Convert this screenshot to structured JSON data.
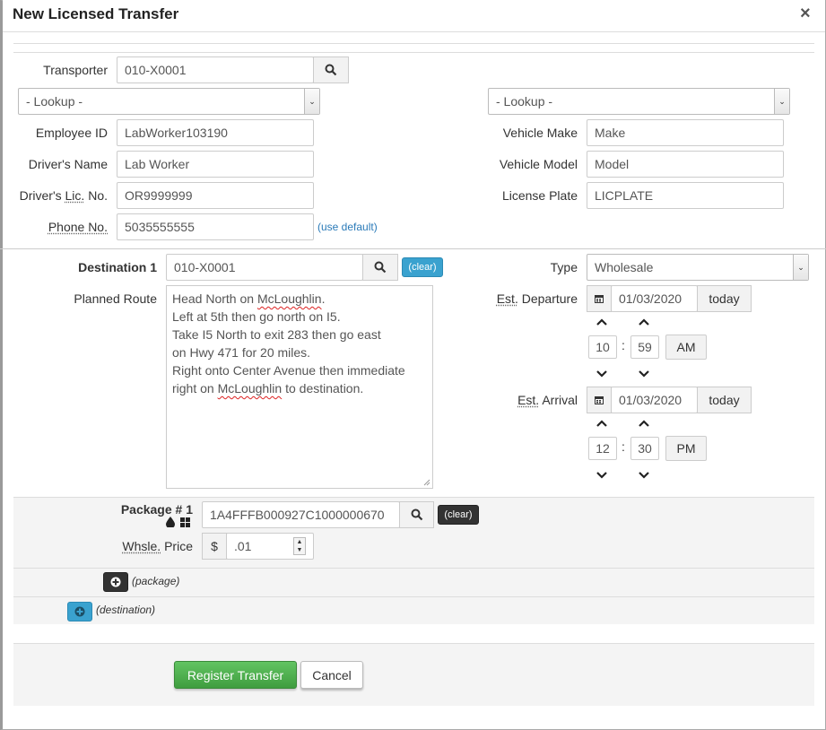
{
  "dialog": {
    "title": "New Licensed Transfer",
    "close": "×"
  },
  "transporter": {
    "label": "Transporter",
    "value": "010-X0001",
    "lookup_left": "- Lookup -",
    "lookup_right": "- Lookup -",
    "employee_id_label": "Employee ID",
    "employee_id": "LabWorker103190",
    "driver_name_label": "Driver's Name",
    "driver_name": "Lab Worker",
    "driver_lic_label_pre": "Driver's ",
    "driver_lic_label_abbr": "Lic.",
    "driver_lic_label_post": " No.",
    "driver_lic": "OR9999999",
    "phone_label": "Phone No.",
    "phone": "5035555555",
    "use_default": "(use default)",
    "vehicle_make_label": "Vehicle Make",
    "vehicle_make": "Make",
    "vehicle_model_label": "Vehicle Model",
    "vehicle_model": "Model",
    "license_plate_label": "License Plate",
    "license_plate": "LICPLATE"
  },
  "destination": {
    "label": "Destination 1",
    "value": "010-X0001",
    "clear": "(clear)",
    "route_label": "Planned Route",
    "route_lines": [
      [
        "Head North on ",
        "McLoughlin",
        "."
      ],
      [
        "Left at 5th then go north on I5.",
        "",
        ""
      ],
      [
        "Take I5 North to exit 283 then go east",
        "",
        ""
      ],
      [
        "on Hwy 471 for 20 miles.",
        "",
        ""
      ],
      [
        "Right onto Center Avenue then immediate",
        "",
        ""
      ],
      [
        "right on ",
        "McLoughlin",
        " to destination."
      ]
    ],
    "type_label": "Type",
    "type_value": "Wholesale",
    "departure_label_abbr": "Est.",
    "departure_label_rest": " Departure",
    "departure_date": "01/03/2020",
    "departure_today": "today",
    "departure_hour": "10",
    "departure_min": "59",
    "departure_ampm": "AM",
    "arrival_label_abbr": "Est.",
    "arrival_label_rest": " Arrival",
    "arrival_date": "01/03/2020",
    "arrival_today": "today",
    "arrival_hour": "12",
    "arrival_min": "30",
    "arrival_ampm": "PM",
    "time_sep": ":"
  },
  "package": {
    "label": "Package # 1",
    "value": "1A4FFFB000927C1000000670",
    "clear": "(clear)",
    "price_label_abbr": "Whsle.",
    "price_label_rest": " Price",
    "currency": "$",
    "price": ".01",
    "add_package": "(package)",
    "add_destination": "(destination)"
  },
  "footer": {
    "register": "Register Transfer",
    "cancel": "Cancel"
  },
  "colors": {
    "accent_blue": "#3aa2cf",
    "green": "#4cae4c",
    "panel": "#f4f4f4"
  },
  "icons": [
    "search-icon",
    "calendar-icon",
    "chevron-up-icon",
    "chevron-down-icon",
    "plus-circle-icon",
    "droplet-icon",
    "grid-icon"
  ]
}
